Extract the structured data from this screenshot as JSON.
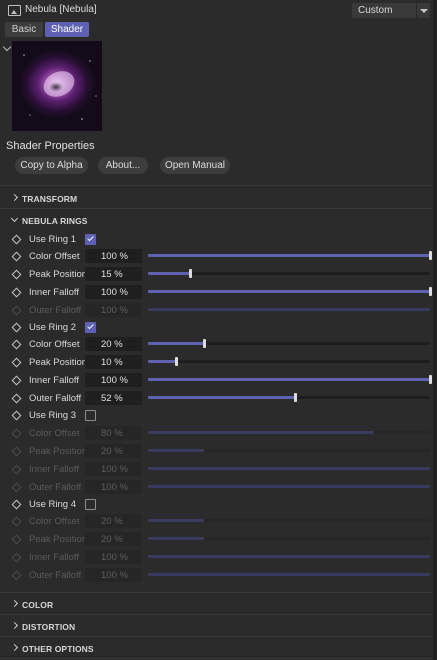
{
  "header": {
    "title": "Nebula [Nebula]",
    "preset": "Custom"
  },
  "tabs": {
    "basic": "Basic",
    "shader": "Shader"
  },
  "shader_properties": {
    "title": "Shader Properties",
    "copy_to_alpha": "Copy to Alpha",
    "about": "About...",
    "open_manual": "Open Manual"
  },
  "groups": {
    "transform": "TRANSFORM",
    "nebula_rings": "NEBULA RINGS",
    "color": "COLOR",
    "distortion": "DISTORTION",
    "other_options": "OTHER OPTIONS"
  },
  "rings": [
    {
      "use_label": "Use Ring 1",
      "enabled": true,
      "params": [
        {
          "label": "Color Offset",
          "value": "100 %",
          "fraction": 1.0
        },
        {
          "label": "Peak Position",
          "value": "15 %",
          "fraction": 0.15
        },
        {
          "label": "Inner Falloff",
          "value": "100 %",
          "fraction": 1.0
        },
        {
          "label": "Outer Falloff",
          "value": "100 %",
          "fraction": 1.0
        }
      ]
    },
    {
      "use_label": "Use Ring 2",
      "enabled": true,
      "params": [
        {
          "label": "Color Offset",
          "value": "20 %",
          "fraction": 0.2
        },
        {
          "label": "Peak Position",
          "value": "10 %",
          "fraction": 0.1
        },
        {
          "label": "Inner Falloff",
          "value": "100 %",
          "fraction": 1.0
        },
        {
          "label": "Outer Falloff",
          "value": "52 %",
          "fraction": 0.52
        }
      ]
    },
    {
      "use_label": "Use Ring 3",
      "enabled": false,
      "params": [
        {
          "label": "Color Offset",
          "value": "80 %",
          "fraction": 0.8
        },
        {
          "label": "Peak Position",
          "value": "20 %",
          "fraction": 0.2
        },
        {
          "label": "Inner Falloff",
          "value": "100 %",
          "fraction": 1.0
        },
        {
          "label": "Outer Falloff",
          "value": "100 %",
          "fraction": 1.0
        }
      ]
    },
    {
      "use_label": "Use Ring 4",
      "enabled": false,
      "params": [
        {
          "label": "Color Offset",
          "value": "20 %",
          "fraction": 0.2
        },
        {
          "label": "Peak Position",
          "value": "20 %",
          "fraction": 0.2
        },
        {
          "label": "Inner Falloff",
          "value": "100 %",
          "fraction": 1.0
        },
        {
          "label": "Outer Falloff",
          "value": "100 %",
          "fraction": 1.0
        }
      ]
    }
  ],
  "ring1_outer_falloff_disabled": true,
  "colors": {
    "accent": "#5e61b3",
    "background": "#2b2b2b"
  },
  "icons": {
    "app": "image-icon",
    "preset": "chevron-down-icon",
    "keyframe": "diamond-icon"
  }
}
